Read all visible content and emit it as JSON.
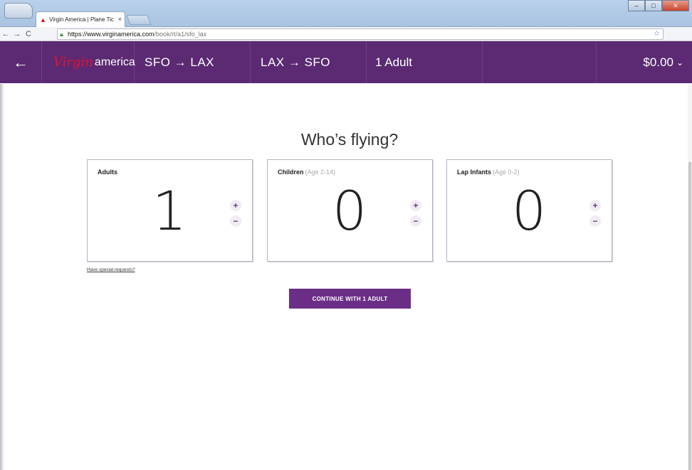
{
  "browser": {
    "tab_title": "Virgin America | Plane Tic",
    "tab_close": "×",
    "url_host": "https://www.virginamerica.com",
    "url_path": "/book/rt/a1/sfo_lax"
  },
  "nav": {
    "back_glyph": "←",
    "brand": "america",
    "outbound": "SFO → LAX",
    "inbound": "LAX → SFO",
    "passengers": "1 Adult",
    "total": "$0.00"
  },
  "main": {
    "title": "Who’s flying?",
    "cards": [
      {
        "label": "Adults",
        "sub": "",
        "count": "1"
      },
      {
        "label": "Children",
        "sub": "(Age 2-14)",
        "count": "0"
      },
      {
        "label": "Lap Infants",
        "sub": "(Age 0-2)",
        "count": "0"
      }
    ],
    "plus": "+",
    "minus": "−",
    "special_requests": "Have special requests?",
    "continue_label": "CONTINUE WITH 1 ADULT"
  },
  "colors": {
    "brand_purple": "#5b2a73",
    "button_purple": "#6b2e86",
    "logo_red": "#e8102e"
  }
}
